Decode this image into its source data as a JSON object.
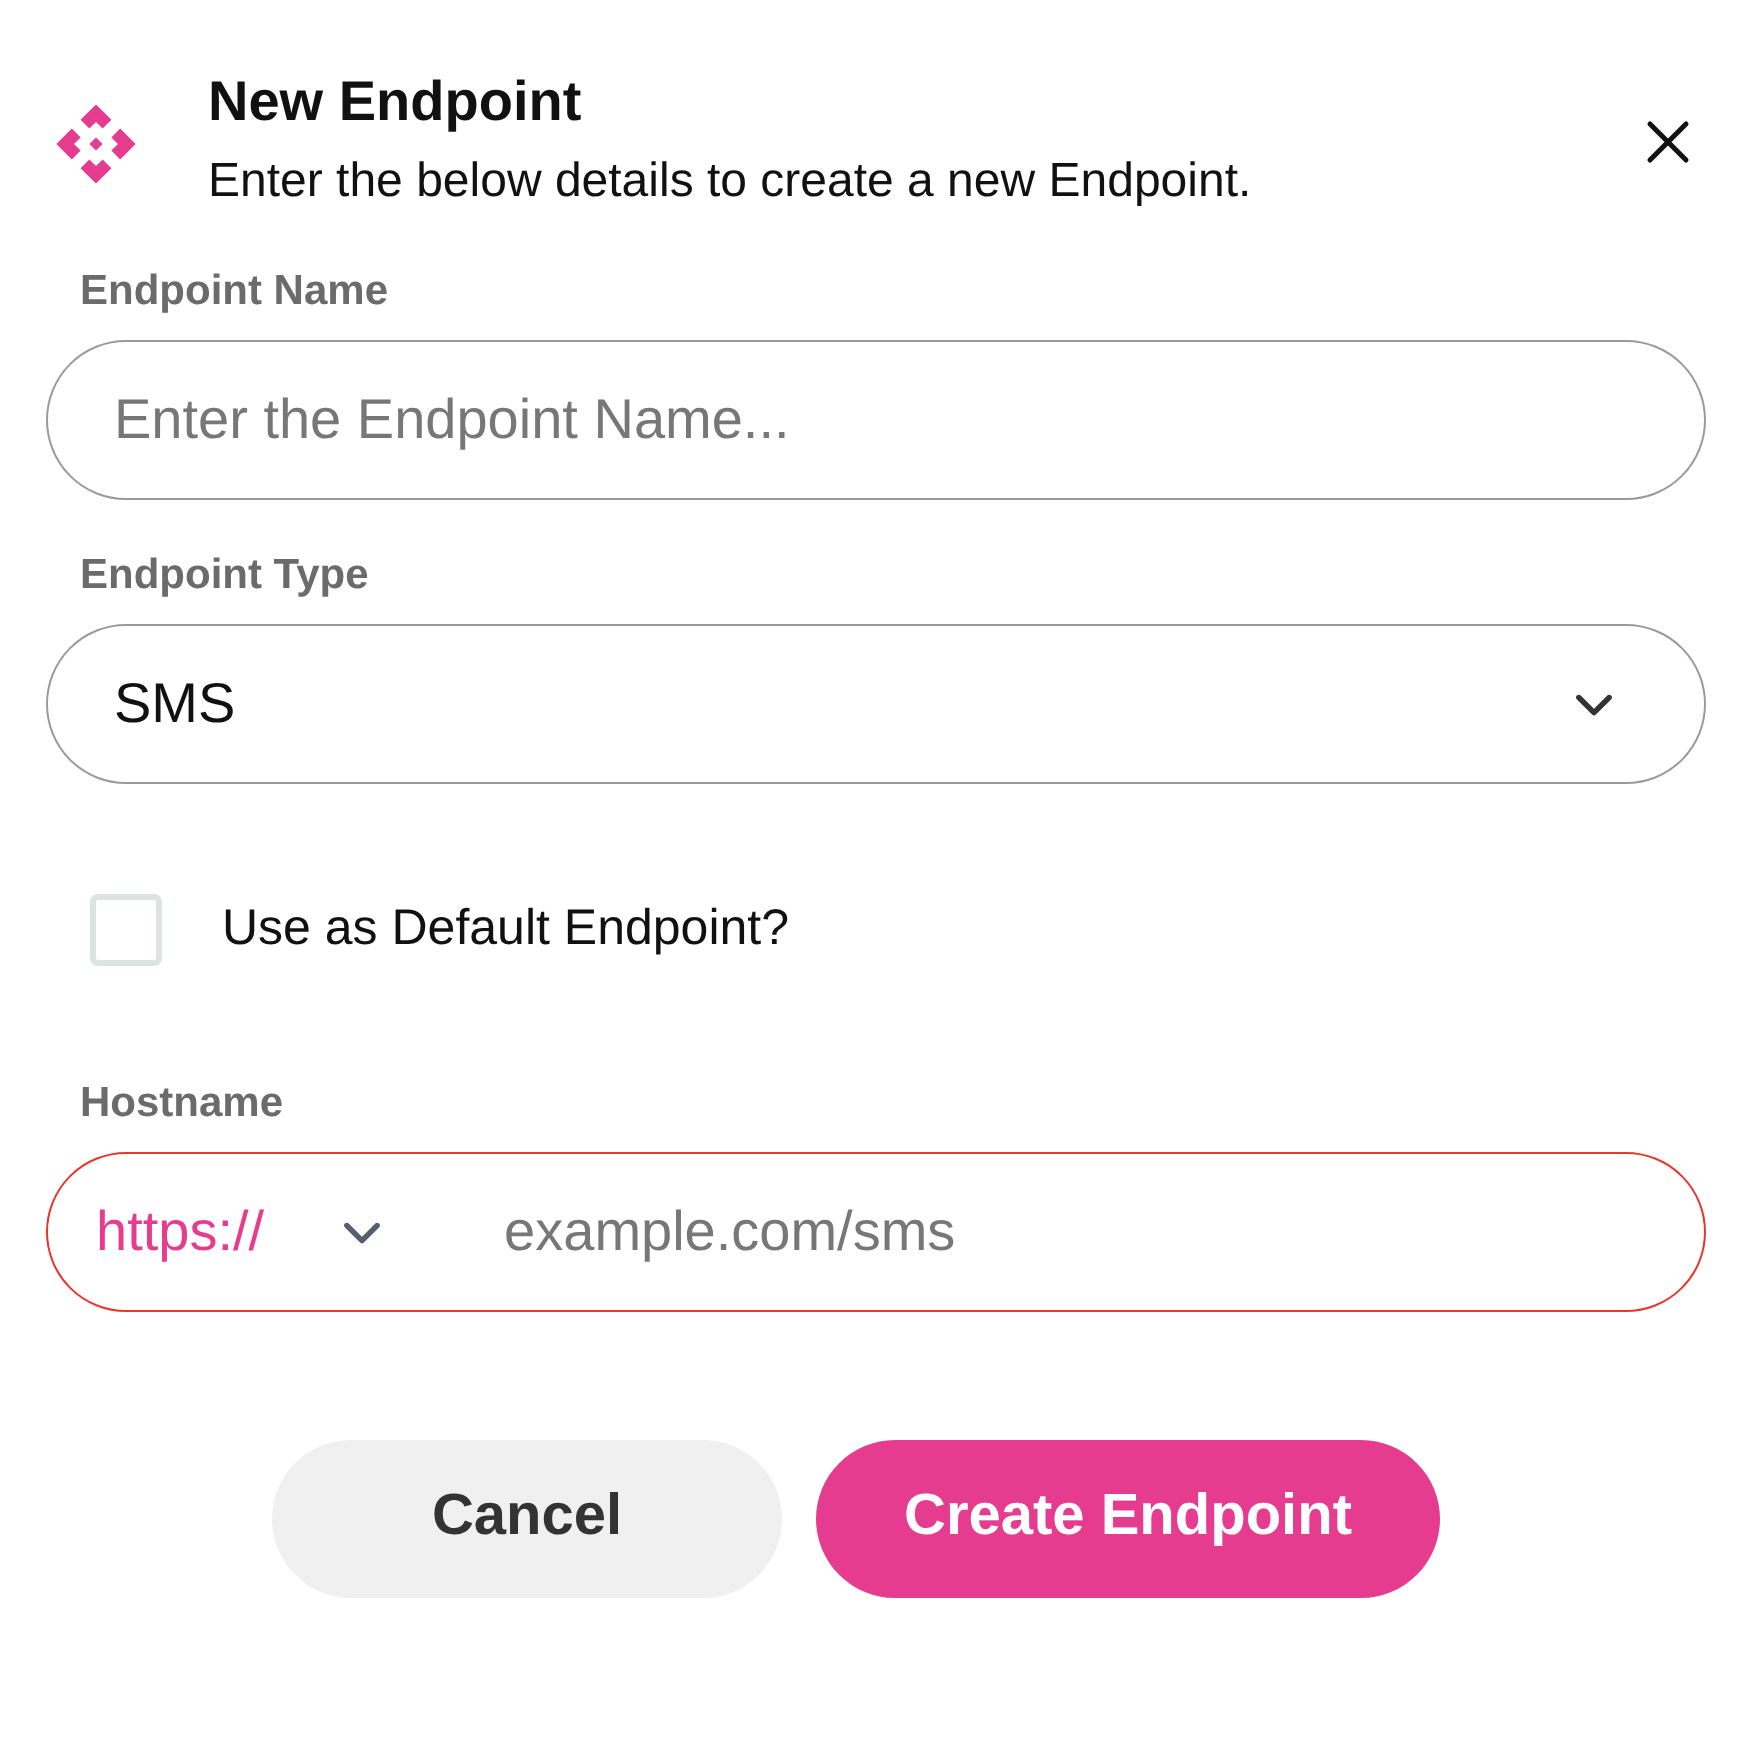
{
  "dialog": {
    "title": "New Endpoint",
    "subtitle": "Enter the below details to create a new Endpoint."
  },
  "fields": [
    {
      "kind": "text",
      "label": "Endpoint Name",
      "placeholder": "Enter the Endpoint Name..."
    },
    {
      "kind": "select",
      "label": "Endpoint Type",
      "value": "SMS"
    }
  ],
  "default_checkbox": {
    "label": "Use as Default Endpoint?",
    "checked": false
  },
  "hostname": {
    "label": "Hostname",
    "protocol": "https://",
    "placeholder": "example.com/sms",
    "invalid": true
  },
  "buttons": [
    {
      "label": "Cancel",
      "kind": "secondary"
    },
    {
      "label": "Create Endpoint",
      "kind": "primary"
    }
  ]
}
